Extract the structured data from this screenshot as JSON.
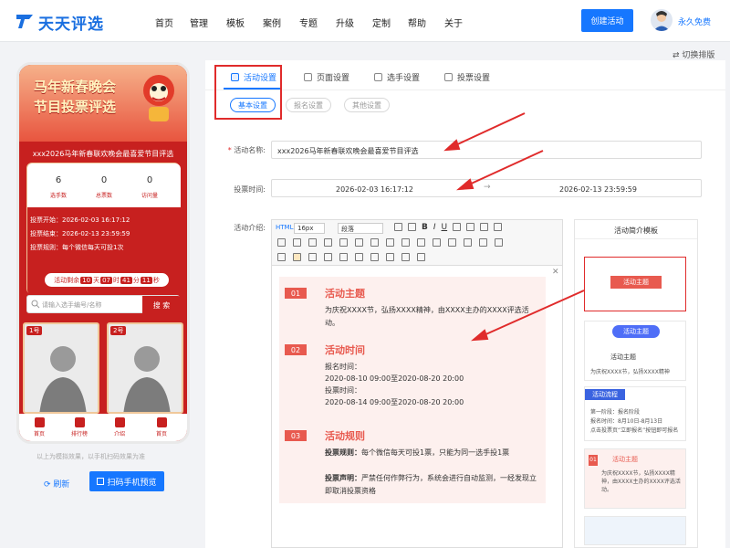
{
  "brand": {
    "name": "天天评选"
  },
  "nav": {
    "items": [
      "首页",
      "管理",
      "模板",
      "案例",
      "专题",
      "升级",
      "定制",
      "帮助",
      "关于"
    ],
    "create_label": "创建活动",
    "user_name": "永久免费"
  },
  "switch_layout": "⇄ 切换排版",
  "phone": {
    "banner_title_line1": "马年新春晚会",
    "banner_title_line2": "节目投票评选",
    "subtitle": "xxx2026马年新春联欢晚会最喜爱节目评选",
    "stats": [
      {
        "num": "6",
        "label": "选手数"
      },
      {
        "num": "0",
        "label": "总票数"
      },
      {
        "num": "0",
        "label": "访问量"
      }
    ],
    "info": [
      "投票开始：2026-02-03 16:17:12",
      "投票结束：2026-02-13 23:59:59",
      "投票规则：每个微信每天可投1次"
    ],
    "countdown": {
      "prefix": "活动剩余",
      "d": "10",
      "h": "07",
      "m": "41",
      "s": "11",
      "u_d": "天",
      "u_h": "时",
      "u_m": "分",
      "u_s": "秒"
    },
    "search_placeholder": "请输入选手编号/名称",
    "search_btn": "搜 索",
    "cards": [
      {
        "num": "1号"
      },
      {
        "num": "2号"
      }
    ],
    "tabs": [
      "首页",
      "排行榜",
      "介绍",
      "首页"
    ]
  },
  "preview_note": "以上为模拟效果，以手机扫码效果为准",
  "refresh_label": "刷新",
  "scan_label": "扫码手机预览",
  "tabs": [
    "活动设置",
    "页面设置",
    "选手设置",
    "投票设置"
  ],
  "subtabs": [
    "基本设置",
    "报名设置",
    "其他设置"
  ],
  "form": {
    "name_label": "活动名称:",
    "name_value": "xxx2026马年新春联欢晚会最喜爱节目评选",
    "time_label": "投票时间:",
    "time_start": "2026-02-03 16:17:12",
    "time_sep": "→",
    "time_end": "2026-02-13 23:59:59",
    "intro_label": "活动介绍:"
  },
  "editor": {
    "font_size": "16px",
    "paragraph": "段落",
    "sections": [
      {
        "num": "01",
        "title": "活动主题",
        "lines": [
          "为庆祝XXXX节，弘扬XXXX精神，由XXXX主办的XXXX评选活动。"
        ]
      },
      {
        "num": "02",
        "title": "活动时间",
        "lines": [
          "报名时间：",
          "2020-08-10 09:00至2020-08-20 20:00",
          "投票时间：",
          "2020-08-14 09:00至2020-08-20 20:00"
        ]
      },
      {
        "num": "03",
        "title": "活动规则",
        "rules": [
          {
            "k": "投票规则：",
            "v": "每个微信每天可投1票，只能为同一选手投1票"
          },
          {
            "k": "投票声明：",
            "v": "严禁任何作弊行为，系统会进行自动监测，一经发现立即取消投票资格"
          }
        ]
      }
    ]
  },
  "template_panel": {
    "title": "活动简介模板",
    "card_titles": [
      "活动主题",
      "活动主题",
      "活动主题",
      "活动流程",
      "活动主题"
    ],
    "card_text": [
      "为庆祝XXXX节，弘扬XXXX精神",
      "第一阶段：报名阶段",
      "报名时间：8月10日-8月13日",
      "点击投票页“立即报名”按钮即可报名",
      "为庆祝XXXX节，弘扬XXXX精神，由XXXX主办的XXXX评选活动。"
    ],
    "tag_01": "01"
  },
  "colors": {
    "brand_blue": "#1677ff",
    "red": "#c7201f",
    "arrow": "#e02b2b"
  }
}
